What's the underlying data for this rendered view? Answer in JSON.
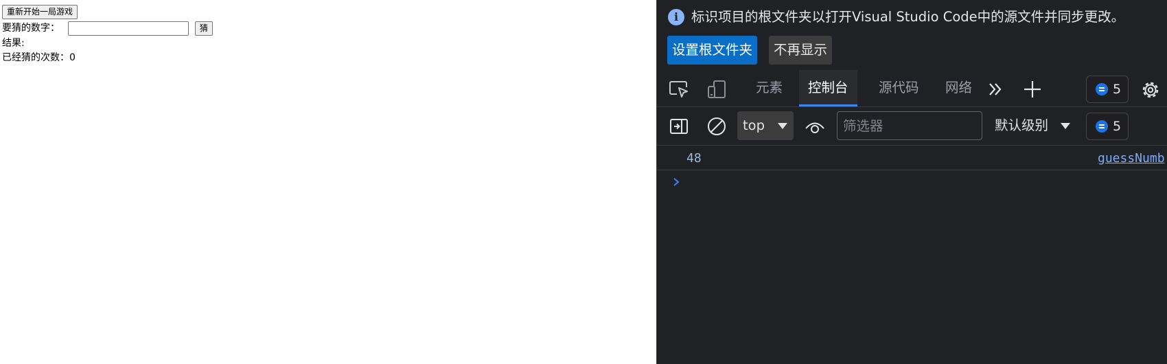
{
  "page": {
    "restart_button": "重新开始一局游戏",
    "guess_label": "要猜的数字：",
    "guess_input_value": "",
    "guess_button": "猜",
    "result_label": "结果:",
    "count_label": "已经猜的次数：",
    "count_value": "0"
  },
  "devtools": {
    "infobar": {
      "message": "标识项目的根文件夹以打开Visual Studio Code中的源文件并同步更改。",
      "set_root_button": "设置根文件夹",
      "dont_show_button": "不再显示"
    },
    "tabs": {
      "elements": "元素",
      "console": "控制台",
      "sources": "源代码",
      "network": "网络"
    },
    "issues_count": "5",
    "toolbar": {
      "context": "top",
      "filter_placeholder": "筛选器",
      "level": "默认级别",
      "issues_count": "5"
    },
    "console": {
      "log_value": "48",
      "log_source": "guessNumb"
    },
    "icons": [
      "info-icon",
      "inspect-icon",
      "device-toolbar-icon",
      "more-tabs-icon",
      "add-tab-icon",
      "issues-icon",
      "settings-icon",
      "sidebar-toggle-icon",
      "clear-console-icon",
      "dropdown-caret-icon",
      "eye-icon",
      "prompt-chevron-icon"
    ],
    "colors": {
      "panel_bg": "#202124",
      "active_tab_indicator": "#3b86f2",
      "primary_button": "#0a6ec7",
      "link": "#7cacf8",
      "info_icon": "#8ab4f8"
    }
  }
}
